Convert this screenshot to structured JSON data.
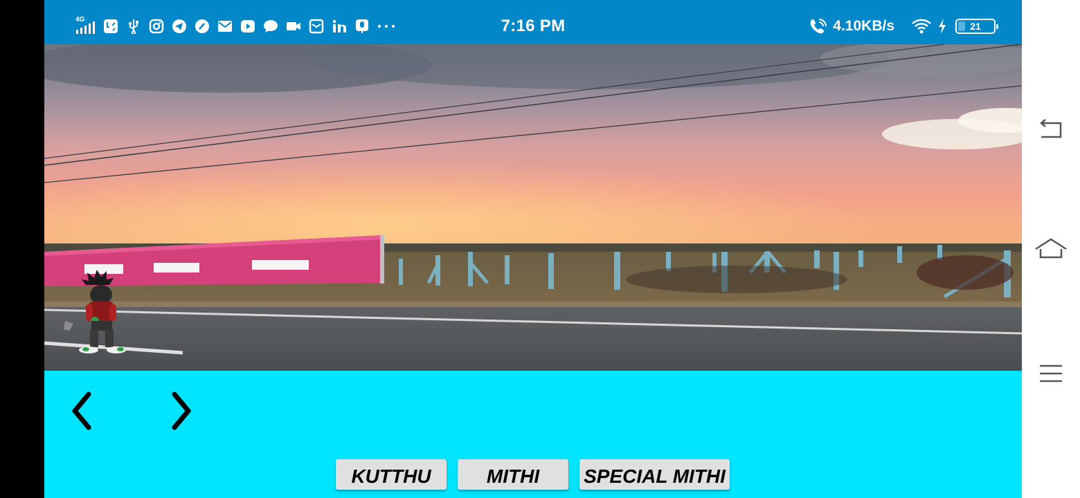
{
  "status_bar": {
    "network": "4G",
    "time": "7:16 PM",
    "net_speed": "4.10KB/s",
    "battery_level": "21",
    "battery_fraction": 0.21,
    "notification_icons": [
      "signal-icon",
      "data-saver-icon",
      "usb-icon",
      "instagram-icon",
      "telegram-icon",
      "speedometer-icon",
      "mail-icon",
      "youtube-icon",
      "chat-bubble-icon",
      "video-call-icon",
      "inbox-icon",
      "linkedin-icon",
      "microphone-icon",
      "more-dots-icon"
    ],
    "right_icons": [
      "wifi-calling-icon",
      "wifi-icon",
      "charging-bolt-icon",
      "battery-icon"
    ],
    "color": "#0288c8"
  },
  "game": {
    "scene": "sunset-roadside-background",
    "character": "player-sprite",
    "background_color": "#00e5ff"
  },
  "controls": {
    "prev_icon": "chevron-left-icon",
    "next_icon": "chevron-right-icon",
    "buttons": [
      "KUTTHU",
      "MITHI",
      "SPECIAL MITHI"
    ]
  },
  "nav_bar": {
    "icons": [
      "back-icon",
      "home-icon",
      "menu-icon"
    ]
  }
}
